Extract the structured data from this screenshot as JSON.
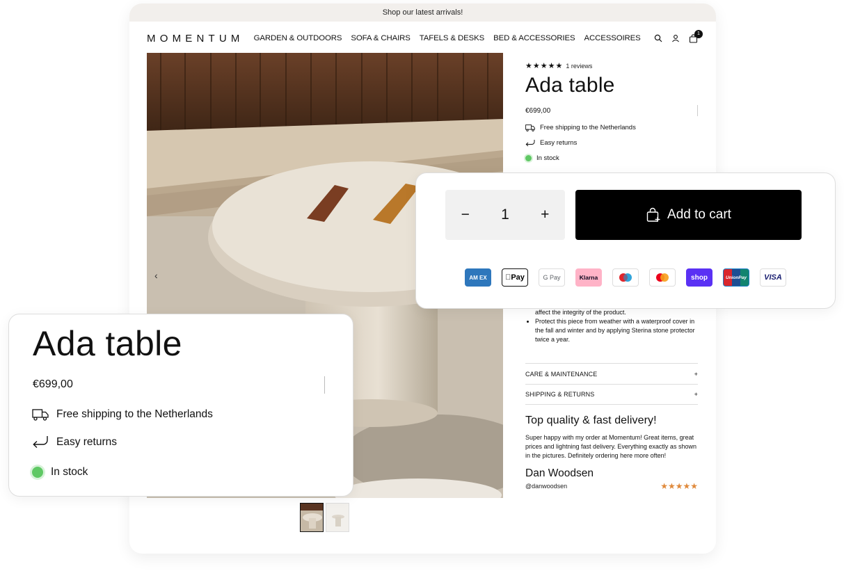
{
  "announcement": "Shop our latest arrivals!",
  "nav": {
    "logo": "MOMENTUM",
    "menu": [
      "GARDEN & OUTDOORS",
      "SOFA & CHAIRS",
      "TAFELS & DESKS",
      "BED & ACCESSORIES",
      "ACCESSOIRES"
    ],
    "cart_count": "1",
    "icons": [
      "search-icon",
      "user-icon",
      "cart-icon"
    ]
  },
  "product": {
    "rating_stars": 5,
    "reviews": "1 reviews",
    "title": "Ada table",
    "price": "€699,00",
    "shipping": "Free shipping to the Netherlands",
    "returns": "Easy returns",
    "stock": "In stock",
    "stock_color": "#5fc864"
  },
  "description": {
    "line_partial": "affect the integrity of the product.",
    "bullet": "Protect this piece from weather with a waterproof cover in the fall and winter and by applying Sterina stone protector twice a year."
  },
  "accordions": [
    {
      "label": "CARE & MAINTENANCE",
      "icon": "+"
    },
    {
      "label": "SHIPPING & RETURNS",
      "icon": "+"
    }
  ],
  "testimonial": {
    "title": "Top quality & fast delivery!",
    "body": "Super happy with my order at Momentum! Great items, great prices and lightning fast delivery. Everything exactly as shown in the pictures. Definitely ordering here more often!",
    "name": "Dan Woodsen",
    "handle": "@danwoodsen",
    "stars_color": "#e08a3c"
  },
  "cart_card": {
    "minus": "−",
    "quantity": "1",
    "plus": "+",
    "add_to_cart": "Add to cart",
    "payments": [
      {
        "label": "AM EX",
        "bg": "#2e77bc",
        "fg": "#ffffff"
      },
      {
        "label": "Pay",
        "bg": "#ffffff",
        "fg": "#000000"
      },
      {
        "label": "G Pay",
        "bg": "#ffffff",
        "fg": "#5f6368"
      },
      {
        "label": "Klarna",
        "bg": "#ffb3c7",
        "fg": "#0b051d"
      },
      {
        "label": "maestro",
        "bg": "#ffffff",
        "fg": "#000000"
      },
      {
        "label": "mastercard",
        "bg": "#ffffff",
        "fg": "#000000"
      },
      {
        "label": "shop",
        "bg": "#5a31f4",
        "fg": "#ffffff"
      },
      {
        "label": "UnionPay",
        "bg": "#1c7ec4",
        "fg": "#ffffff"
      },
      {
        "label": "VISA",
        "bg": "#ffffff",
        "fg": "#1a1f71"
      }
    ]
  },
  "hero": {
    "prev_arrow": "‹"
  }
}
